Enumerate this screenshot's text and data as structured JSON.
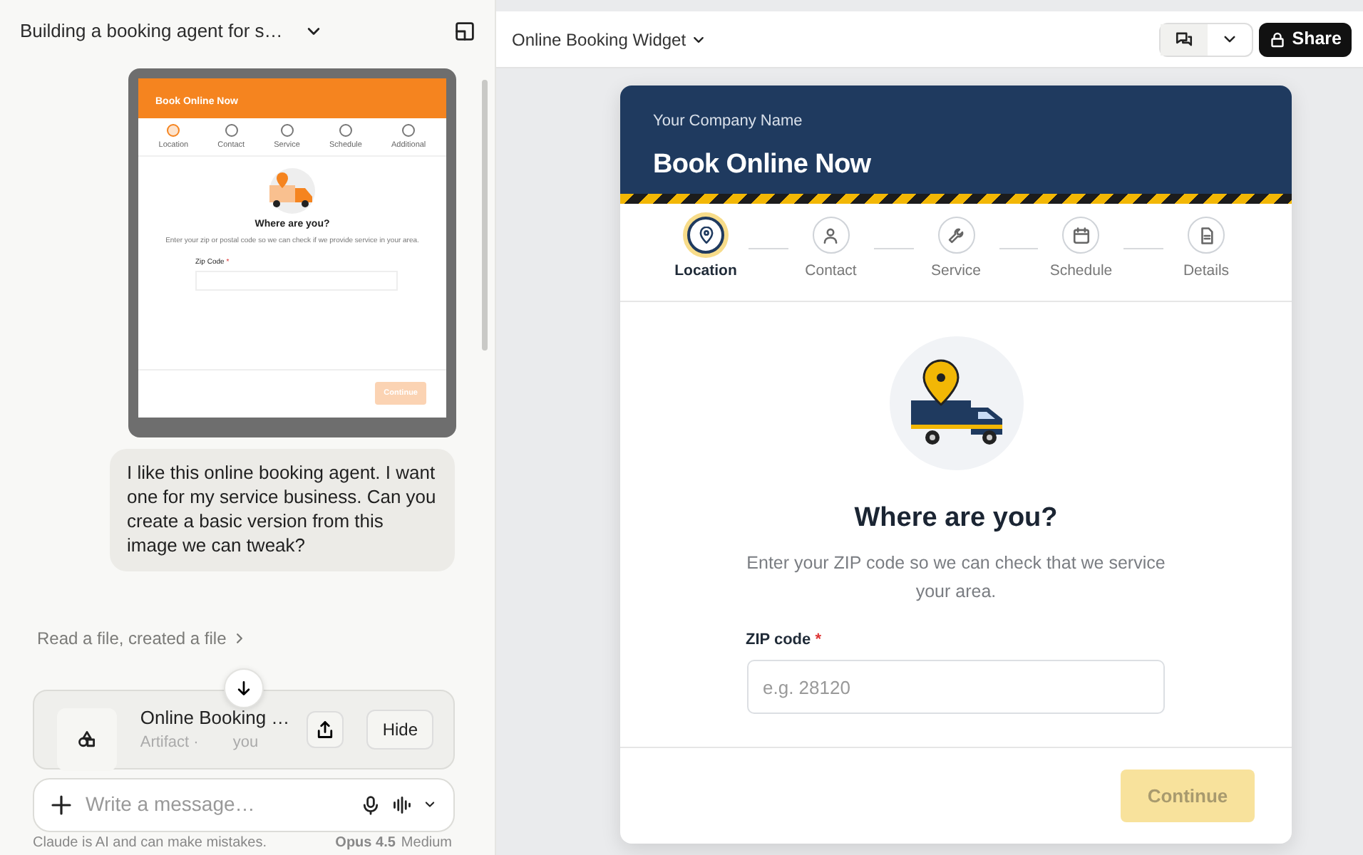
{
  "chat": {
    "title": "Building a booking agent for s…",
    "thumbnail": {
      "heading": "Book Online Now",
      "steps": [
        {
          "label": "Location",
          "selected": true
        },
        {
          "label": "Contact",
          "selected": false
        },
        {
          "label": "Service",
          "selected": false
        },
        {
          "label": "Schedule",
          "selected": false
        },
        {
          "label": "Additional",
          "selected": false
        }
      ],
      "question": "Where are you?",
      "description": "Enter your zip or postal code so we can check if we provide service in your area.",
      "field_label": "Zip Code",
      "required_mark": "*",
      "button": "Continue"
    },
    "message": "I like this online booking agent. I want one for my service business. Can you create a basic version from this image we can tweak?",
    "activity": "Read a file, created a file",
    "artifact_card": {
      "title": "Online Booking …",
      "subtitle_start": "Artifact ·",
      "subtitle_end": "you",
      "button": "Hide"
    },
    "composer": {
      "placeholder": "Write a message…"
    },
    "disclaimer": "Claude is AI and can make mistakes.",
    "model": "Opus 4.5",
    "effort": "Medium"
  },
  "artifact": {
    "title": "Online Booking Widget",
    "chat_view_selected": true,
    "share": "Share",
    "widget": {
      "company": "Your Company Name",
      "heading": "Book Online Now",
      "steps": [
        {
          "label": "Location",
          "selected": true
        },
        {
          "label": "Contact",
          "selected": false
        },
        {
          "label": "Service",
          "selected": false
        },
        {
          "label": "Schedule",
          "selected": false
        },
        {
          "label": "Details",
          "selected": false
        }
      ],
      "question": "Where are you?",
      "description": "Enter your ZIP code so we can check that we service your area.",
      "field": {
        "label": "ZIP code",
        "required_mark": "*",
        "placeholder": "e.g. 28120"
      },
      "continue": {
        "label": "Continue",
        "disabled": true
      }
    }
  }
}
